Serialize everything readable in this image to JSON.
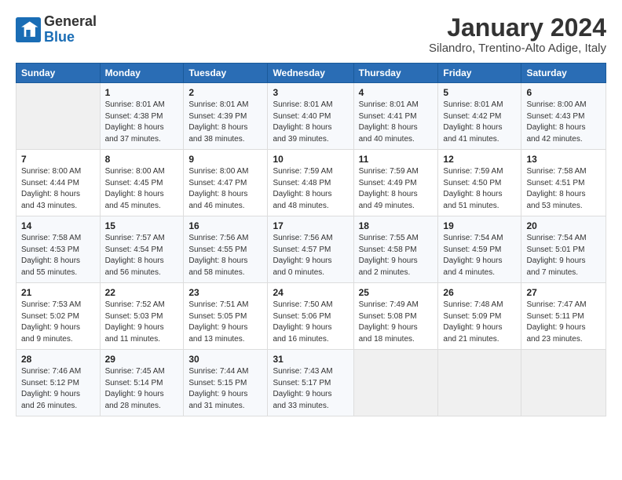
{
  "logo": {
    "text_general": "General",
    "text_blue": "Blue"
  },
  "header": {
    "title": "January 2024",
    "subtitle": "Silandro, Trentino-Alto Adige, Italy"
  },
  "days_of_week": [
    "Sunday",
    "Monday",
    "Tuesday",
    "Wednesday",
    "Thursday",
    "Friday",
    "Saturday"
  ],
  "weeks": [
    [
      {
        "day": "",
        "info": ""
      },
      {
        "day": "1",
        "info": "Sunrise: 8:01 AM\nSunset: 4:38 PM\nDaylight: 8 hours\nand 37 minutes."
      },
      {
        "day": "2",
        "info": "Sunrise: 8:01 AM\nSunset: 4:39 PM\nDaylight: 8 hours\nand 38 minutes."
      },
      {
        "day": "3",
        "info": "Sunrise: 8:01 AM\nSunset: 4:40 PM\nDaylight: 8 hours\nand 39 minutes."
      },
      {
        "day": "4",
        "info": "Sunrise: 8:01 AM\nSunset: 4:41 PM\nDaylight: 8 hours\nand 40 minutes."
      },
      {
        "day": "5",
        "info": "Sunrise: 8:01 AM\nSunset: 4:42 PM\nDaylight: 8 hours\nand 41 minutes."
      },
      {
        "day": "6",
        "info": "Sunrise: 8:00 AM\nSunset: 4:43 PM\nDaylight: 8 hours\nand 42 minutes."
      }
    ],
    [
      {
        "day": "7",
        "info": "Sunrise: 8:00 AM\nSunset: 4:44 PM\nDaylight: 8 hours\nand 43 minutes."
      },
      {
        "day": "8",
        "info": "Sunrise: 8:00 AM\nSunset: 4:45 PM\nDaylight: 8 hours\nand 45 minutes."
      },
      {
        "day": "9",
        "info": "Sunrise: 8:00 AM\nSunset: 4:47 PM\nDaylight: 8 hours\nand 46 minutes."
      },
      {
        "day": "10",
        "info": "Sunrise: 7:59 AM\nSunset: 4:48 PM\nDaylight: 8 hours\nand 48 minutes."
      },
      {
        "day": "11",
        "info": "Sunrise: 7:59 AM\nSunset: 4:49 PM\nDaylight: 8 hours\nand 49 minutes."
      },
      {
        "day": "12",
        "info": "Sunrise: 7:59 AM\nSunset: 4:50 PM\nDaylight: 8 hours\nand 51 minutes."
      },
      {
        "day": "13",
        "info": "Sunrise: 7:58 AM\nSunset: 4:51 PM\nDaylight: 8 hours\nand 53 minutes."
      }
    ],
    [
      {
        "day": "14",
        "info": "Sunrise: 7:58 AM\nSunset: 4:53 PM\nDaylight: 8 hours\nand 55 minutes."
      },
      {
        "day": "15",
        "info": "Sunrise: 7:57 AM\nSunset: 4:54 PM\nDaylight: 8 hours\nand 56 minutes."
      },
      {
        "day": "16",
        "info": "Sunrise: 7:56 AM\nSunset: 4:55 PM\nDaylight: 8 hours\nand 58 minutes."
      },
      {
        "day": "17",
        "info": "Sunrise: 7:56 AM\nSunset: 4:57 PM\nDaylight: 9 hours\nand 0 minutes."
      },
      {
        "day": "18",
        "info": "Sunrise: 7:55 AM\nSunset: 4:58 PM\nDaylight: 9 hours\nand 2 minutes."
      },
      {
        "day": "19",
        "info": "Sunrise: 7:54 AM\nSunset: 4:59 PM\nDaylight: 9 hours\nand 4 minutes."
      },
      {
        "day": "20",
        "info": "Sunrise: 7:54 AM\nSunset: 5:01 PM\nDaylight: 9 hours\nand 7 minutes."
      }
    ],
    [
      {
        "day": "21",
        "info": "Sunrise: 7:53 AM\nSunset: 5:02 PM\nDaylight: 9 hours\nand 9 minutes."
      },
      {
        "day": "22",
        "info": "Sunrise: 7:52 AM\nSunset: 5:03 PM\nDaylight: 9 hours\nand 11 minutes."
      },
      {
        "day": "23",
        "info": "Sunrise: 7:51 AM\nSunset: 5:05 PM\nDaylight: 9 hours\nand 13 minutes."
      },
      {
        "day": "24",
        "info": "Sunrise: 7:50 AM\nSunset: 5:06 PM\nDaylight: 9 hours\nand 16 minutes."
      },
      {
        "day": "25",
        "info": "Sunrise: 7:49 AM\nSunset: 5:08 PM\nDaylight: 9 hours\nand 18 minutes."
      },
      {
        "day": "26",
        "info": "Sunrise: 7:48 AM\nSunset: 5:09 PM\nDaylight: 9 hours\nand 21 minutes."
      },
      {
        "day": "27",
        "info": "Sunrise: 7:47 AM\nSunset: 5:11 PM\nDaylight: 9 hours\nand 23 minutes."
      }
    ],
    [
      {
        "day": "28",
        "info": "Sunrise: 7:46 AM\nSunset: 5:12 PM\nDaylight: 9 hours\nand 26 minutes."
      },
      {
        "day": "29",
        "info": "Sunrise: 7:45 AM\nSunset: 5:14 PM\nDaylight: 9 hours\nand 28 minutes."
      },
      {
        "day": "30",
        "info": "Sunrise: 7:44 AM\nSunset: 5:15 PM\nDaylight: 9 hours\nand 31 minutes."
      },
      {
        "day": "31",
        "info": "Sunrise: 7:43 AM\nSunset: 5:17 PM\nDaylight: 9 hours\nand 33 minutes."
      },
      {
        "day": "",
        "info": ""
      },
      {
        "day": "",
        "info": ""
      },
      {
        "day": "",
        "info": ""
      }
    ]
  ]
}
